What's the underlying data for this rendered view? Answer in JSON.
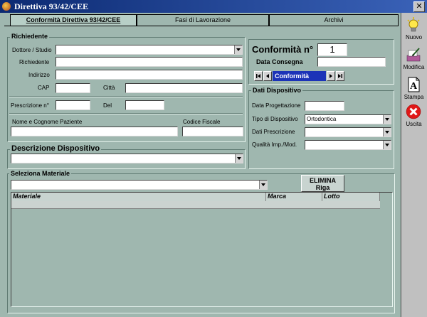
{
  "window": {
    "title": "Direttiva 93/42/CEE",
    "close_glyph": "✕"
  },
  "tabs": [
    {
      "label": "Conformità Direttiva 93/42/CEE",
      "active": true
    },
    {
      "label": "Fasi di Lavorazione",
      "active": false
    },
    {
      "label": "Archivi",
      "active": false
    }
  ],
  "richiedente": {
    "title": "Richiedente",
    "dottore_label": "Dottore / Studio",
    "richiedente_label": "Richiedente",
    "indirizzo_label": "Indirizzo",
    "cap_label": "CAP",
    "citta_label": "Città",
    "prescrizione_label": "Prescrizione n°",
    "del_label": "Del",
    "paziente_label": "Nome e Cognome Paziente",
    "codice_fiscale_label": "Codice Fiscale"
  },
  "conformita": {
    "title": "Conformità n°",
    "number": "1",
    "data_consegna_label": "Data Consegna",
    "nav_label": "Conformità"
  },
  "descrizione": {
    "title": "Descrizione Dispositivo"
  },
  "dati_dispositivo": {
    "title": "Dati Dispositivo",
    "data_progettazione_label": "Data Progettazione",
    "tipo_label": "Tipo di Dispositivo",
    "tipo_value": "Ortodontica",
    "dati_prescrizione_label": "Dati Prescrizione",
    "qualita_label": "Qualità Imp./Mod."
  },
  "materiale": {
    "title": "Seleziona Materiale",
    "delete_button": "ELIMINA Riga",
    "columns": [
      "Materiale",
      "Marca",
      "Lotto"
    ]
  },
  "sidebar": [
    {
      "label": "Nuovo",
      "icon": "lightbulb-icon"
    },
    {
      "label": "Modifica",
      "icon": "edit-icon"
    },
    {
      "label": "Stampa",
      "icon": "print-icon"
    },
    {
      "label": "Uscita",
      "icon": "exit-icon"
    }
  ]
}
